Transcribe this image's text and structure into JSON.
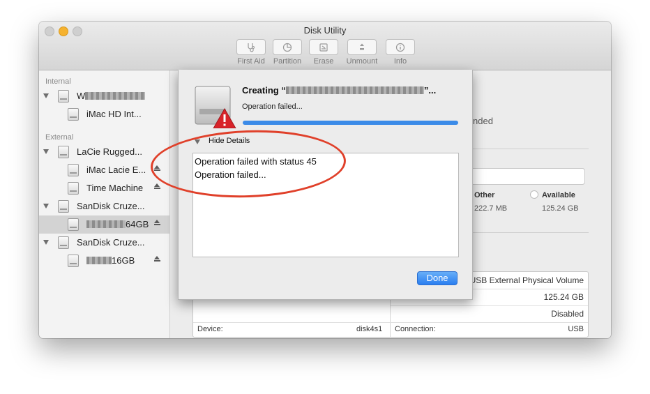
{
  "window": {
    "title": "Disk Utility"
  },
  "toolbar": [
    {
      "label": "First Aid",
      "icon": "stethoscope-icon"
    },
    {
      "label": "Partition",
      "icon": "partition-pie-icon"
    },
    {
      "label": "Erase",
      "icon": "erase-icon"
    },
    {
      "label": "Unmount",
      "icon": "unmount-icon"
    },
    {
      "label": "Info",
      "icon": "info-icon"
    }
  ],
  "sidebar": {
    "internal_header": "Internal",
    "external_header": "External",
    "items": [
      {
        "label_prefix": "W",
        "label_suffix": "",
        "redacted": true
      },
      {
        "label": "iMac HD Int..."
      },
      {
        "label": "LaCie Rugged..."
      },
      {
        "label": "iMac Lacie E...",
        "eject": true
      },
      {
        "label": "Time Machine",
        "eject": true
      },
      {
        "label": "SanDisk Cruze..."
      },
      {
        "label_prefix": "",
        "label_suffix": "64GB",
        "redacted": true,
        "selected": true,
        "eject": true
      },
      {
        "label": "SanDisk Cruze..."
      },
      {
        "label_prefix": "",
        "label_suffix": "16GB",
        "redacted": true,
        "eject": true
      }
    ]
  },
  "main": {
    "status_partial": "nded",
    "legend_other_label": "Other",
    "legend_other_value": "222.7 MB",
    "legend_available_label": "Available",
    "legend_available_value": "125.24 GB",
    "info_rows": [
      {
        "value": "USB External Physical Volume"
      },
      {
        "value": "125.24 GB"
      },
      {
        "value": "Disabled"
      }
    ],
    "device_label": "Device:",
    "device_value": "disk4s1",
    "connection_label": "Connection:",
    "connection_value": "USB"
  },
  "sheet": {
    "title_prefix": "Creating “",
    "title_suffix": "”...",
    "status": "Operation failed...",
    "progress_fraction": 1.0,
    "details_toggle": "Hide Details",
    "log_lines": [
      "Operation failed with status 45",
      "Operation failed..."
    ],
    "done_button": "Done"
  },
  "colors": {
    "accent": "#3b8be8",
    "annotation": "#e0402a",
    "error": "#d8232a"
  }
}
